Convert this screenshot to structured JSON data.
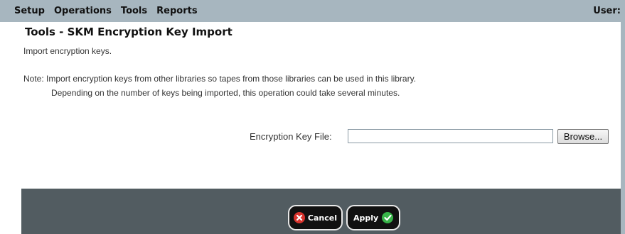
{
  "menubar": {
    "items": [
      "Setup",
      "Operations",
      "Tools",
      "Reports"
    ],
    "user_label": "User:"
  },
  "page": {
    "title": "Tools - SKM Encryption Key Import",
    "description": "Import encryption keys.",
    "note_line1": "Note: Import encryption keys from other libraries so tapes from those libraries can be used in this library.",
    "note_line2": "Depending on the number of keys being imported, this operation could take several minutes."
  },
  "form": {
    "key_file_label": "Encryption Key File:",
    "key_file_value": "",
    "browse_label": "Browse..."
  },
  "footer": {
    "cancel_label": "Cancel",
    "apply_label": "Apply"
  },
  "colors": {
    "menubar_bg": "#a7b6bf",
    "footer_bg": "#525c61",
    "cancel_icon": "#d9332d",
    "apply_icon": "#38b449"
  },
  "icons": {
    "cancel": "x-circle-icon",
    "apply": "checkmark-circle-icon"
  }
}
